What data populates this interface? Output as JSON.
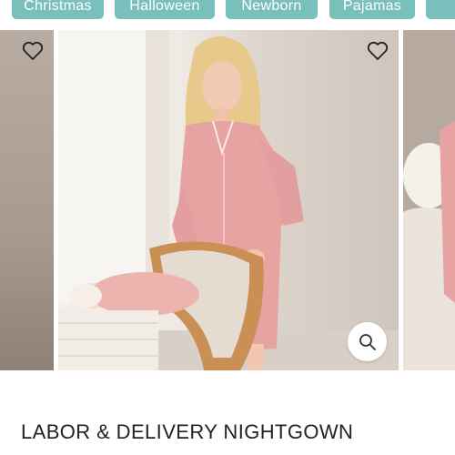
{
  "categories": [
    "Christmas",
    "Halloween",
    "Newborn",
    "Pajamas"
  ],
  "product": {
    "title": "LABOR & DELIVERY NIGHTGOWN"
  },
  "icons": {
    "favorite": "heart-icon",
    "zoom": "magnifier-icon"
  },
  "colors": {
    "chip_bg": "#79bfbb",
    "gown_pink": "#e8a6a6"
  }
}
